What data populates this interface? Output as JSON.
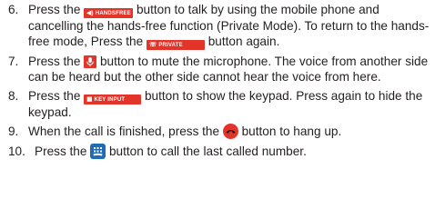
{
  "steps": [
    {
      "number": "6.",
      "before": "Press the ",
      "button1": "HANDSFREE",
      "middle": " button to talk by using the mobile phone and cancelling the hands-free function (Private Mode). To return to the hands-free mode, Press the ",
      "button2": "PRIVATE",
      "after": " button again."
    },
    {
      "number": "7.",
      "before": "Press the ",
      "after": " button to mute the microphone. The voice from another side can be heard but the other side cannot hear the voice from here."
    },
    {
      "number": "8.",
      "before": "Press the ",
      "button": "KEY INPUT",
      "after": " button to show the keypad. Press again to hide the keypad."
    },
    {
      "number": "9.",
      "before": "When the call is finished, press the ",
      "after": " button to hang up."
    },
    {
      "number": "10.",
      "before": "Press the ",
      "after": " button to call the last called number."
    }
  ],
  "colors": {
    "button_red": "#e3342a",
    "redial_blue": "#1f6cb5",
    "text": "#231f20"
  },
  "icons": {
    "handsfree": "speaker-icon",
    "private": "handset-icon",
    "mute": "microphone-icon",
    "keypad": "keypad-grid-icon",
    "hangup": "hang-up-icon",
    "redial": "redial-icon"
  }
}
